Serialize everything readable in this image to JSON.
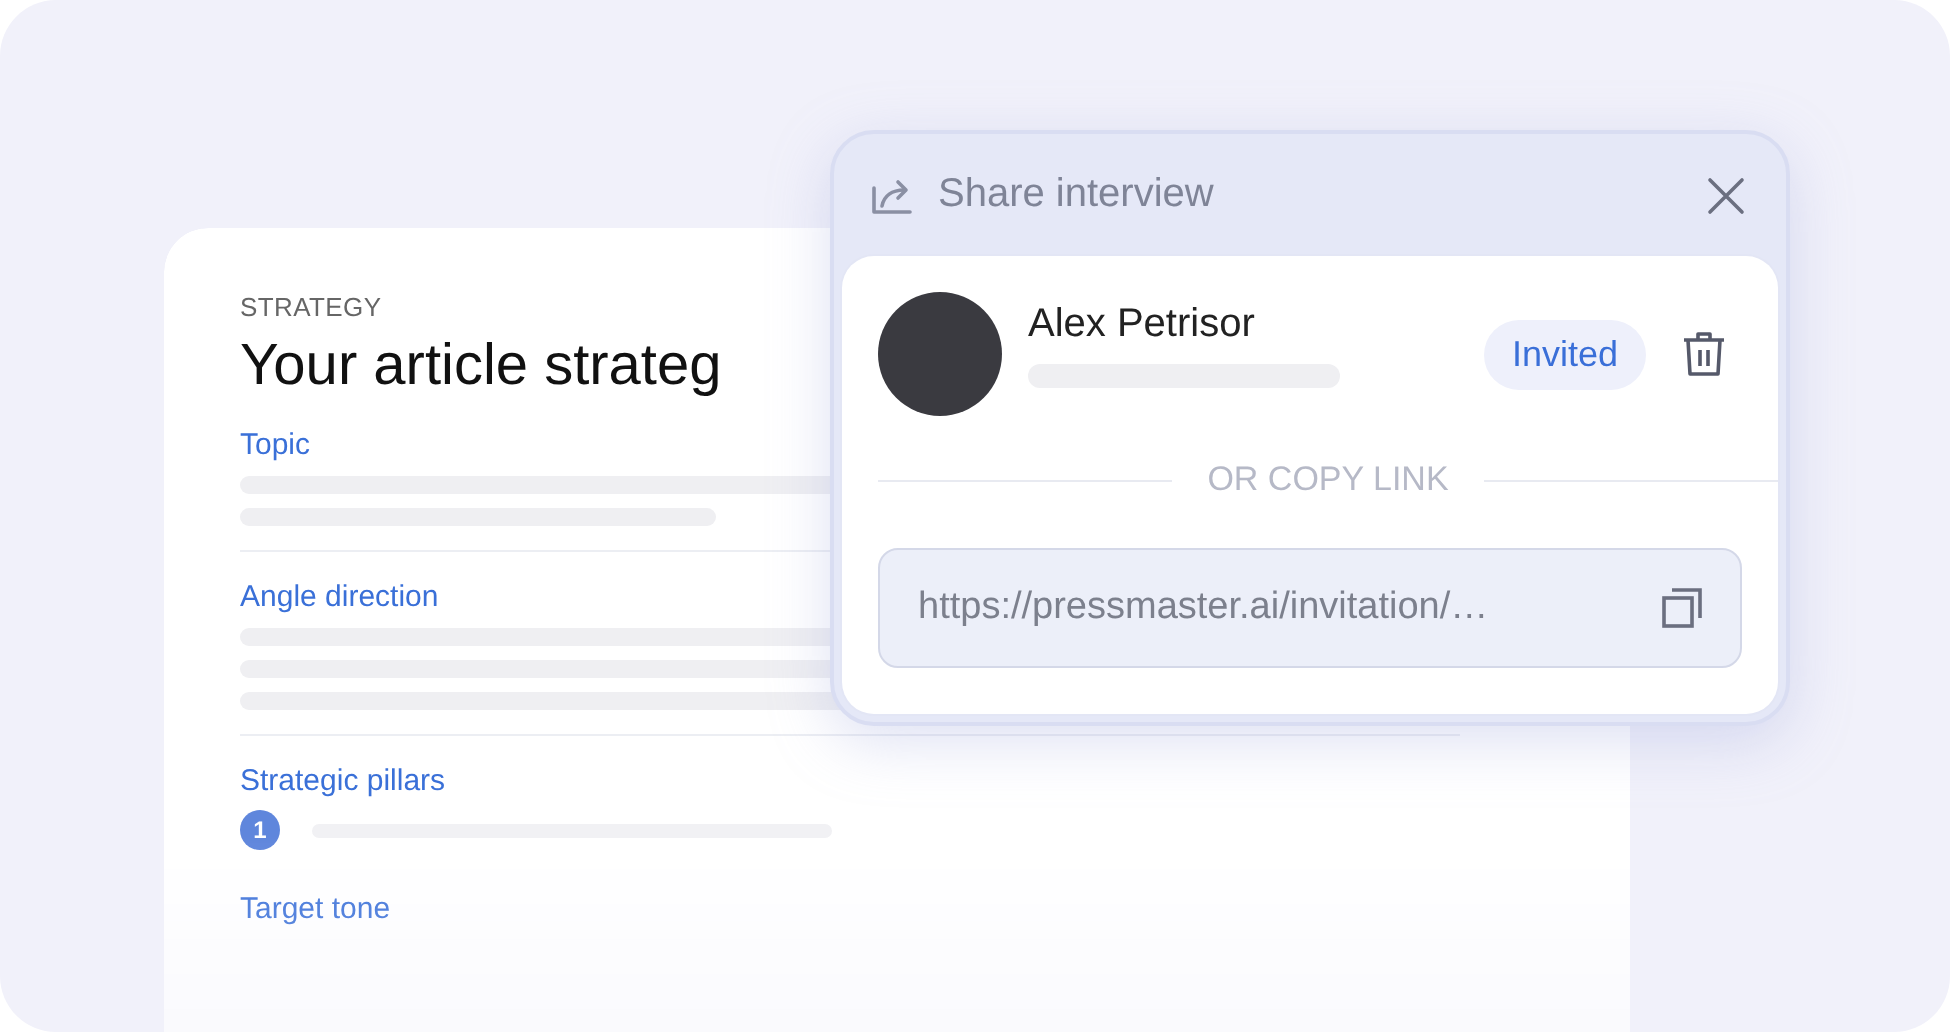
{
  "card": {
    "eyebrow": "STRATEGY",
    "title": "Your article strateg",
    "sections": [
      {
        "kind": "paragraph",
        "label": "Topic"
      },
      {
        "kind": "paragraph",
        "label": "Angle direction"
      },
      {
        "kind": "list",
        "label": "Strategic pillars",
        "items": [
          {
            "number": "1"
          }
        ]
      },
      {
        "kind": "paragraph",
        "label": "Target tone"
      }
    ]
  },
  "dialog": {
    "title": "Share interview",
    "invitee": {
      "name": "Alex Petrisor",
      "status": "Invited"
    },
    "divider": "OR COPY LINK",
    "link": {
      "value": "https://pressmaster.ai/invitation/…"
    }
  }
}
